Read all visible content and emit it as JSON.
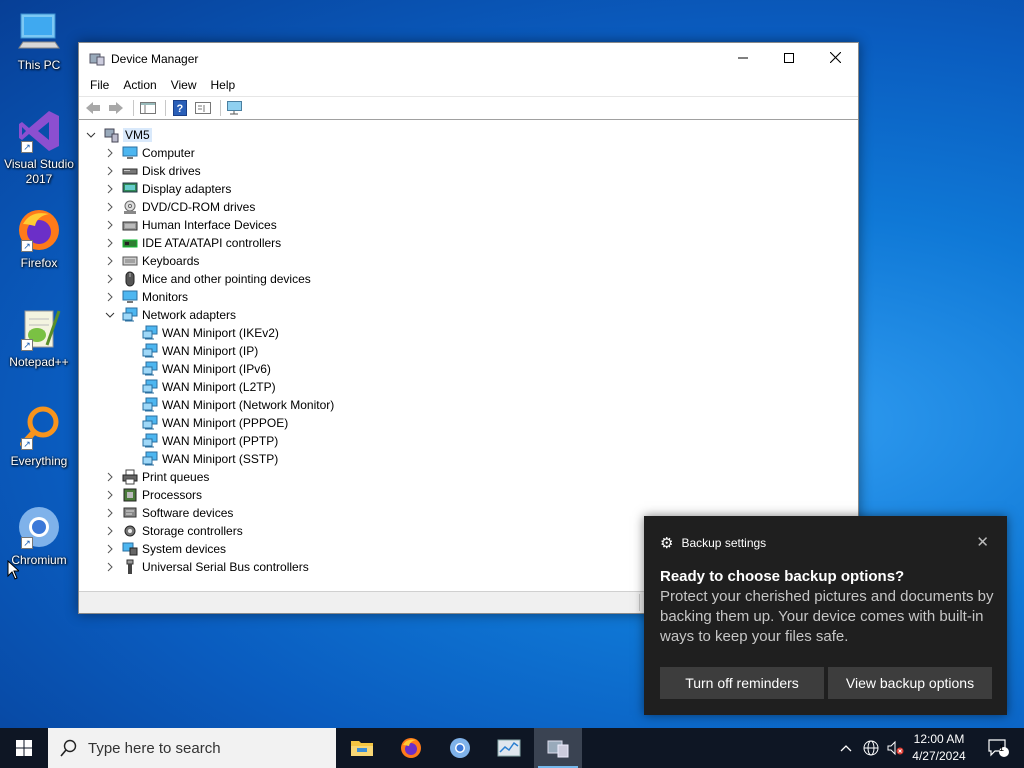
{
  "desktop": {
    "icons": [
      {
        "label": "This PC"
      },
      {
        "label": "Visual Studio 2017"
      },
      {
        "label": "Firefox"
      },
      {
        "label": "Notepad++"
      },
      {
        "label": "Everything"
      },
      {
        "label": "Chromium"
      }
    ]
  },
  "window": {
    "title": "Device Manager",
    "menu": [
      "File",
      "Action",
      "View",
      "Help"
    ],
    "tree": {
      "root": "VM5",
      "categories": [
        {
          "label": "Computer",
          "icon": "computer-icon"
        },
        {
          "label": "Disk drives",
          "icon": "disk-drive-icon"
        },
        {
          "label": "Display adapters",
          "icon": "display-adapter-icon"
        },
        {
          "label": "DVD/CD-ROM drives",
          "icon": "dvd-drive-icon"
        },
        {
          "label": "Human Interface Devices",
          "icon": "hid-icon"
        },
        {
          "label": "IDE ATA/ATAPI controllers",
          "icon": "ide-controller-icon"
        },
        {
          "label": "Keyboards",
          "icon": "keyboard-icon"
        },
        {
          "label": "Mice and other pointing devices",
          "icon": "mouse-icon"
        },
        {
          "label": "Monitors",
          "icon": "monitor-icon"
        },
        {
          "label": "Network adapters",
          "icon": "network-adapter-icon",
          "expanded": true,
          "children": [
            "WAN Miniport (IKEv2)",
            "WAN Miniport (IP)",
            "WAN Miniport (IPv6)",
            "WAN Miniport (L2TP)",
            "WAN Miniport (Network Monitor)",
            "WAN Miniport (PPPOE)",
            "WAN Miniport (PPTP)",
            "WAN Miniport (SSTP)"
          ]
        },
        {
          "label": "Print queues",
          "icon": "printer-icon"
        },
        {
          "label": "Processors",
          "icon": "processor-icon"
        },
        {
          "label": "Software devices",
          "icon": "software-device-icon"
        },
        {
          "label": "Storage controllers",
          "icon": "storage-controller-icon"
        },
        {
          "label": "System devices",
          "icon": "system-device-icon"
        },
        {
          "label": "Universal Serial Bus controllers",
          "icon": "usb-icon"
        }
      ]
    }
  },
  "toast": {
    "app": "Backup settings",
    "heading": "Ready to choose backup options?",
    "body": "Protect your cherished pictures and documents by backing them up. Your device comes with built-in ways to keep your files safe.",
    "btn_off": "Turn off reminders",
    "btn_view": "View backup options"
  },
  "taskbar": {
    "search_placeholder": "Type here to search",
    "time": "12:00 AM",
    "date": "4/27/2024",
    "notification_count": "1"
  },
  "colors": {
    "desktop": "#0a63c9",
    "taskbar": "#0e1624",
    "toast": "#1f1f1f",
    "selection": "#d9e9fb",
    "accent": "#76b9ed"
  }
}
